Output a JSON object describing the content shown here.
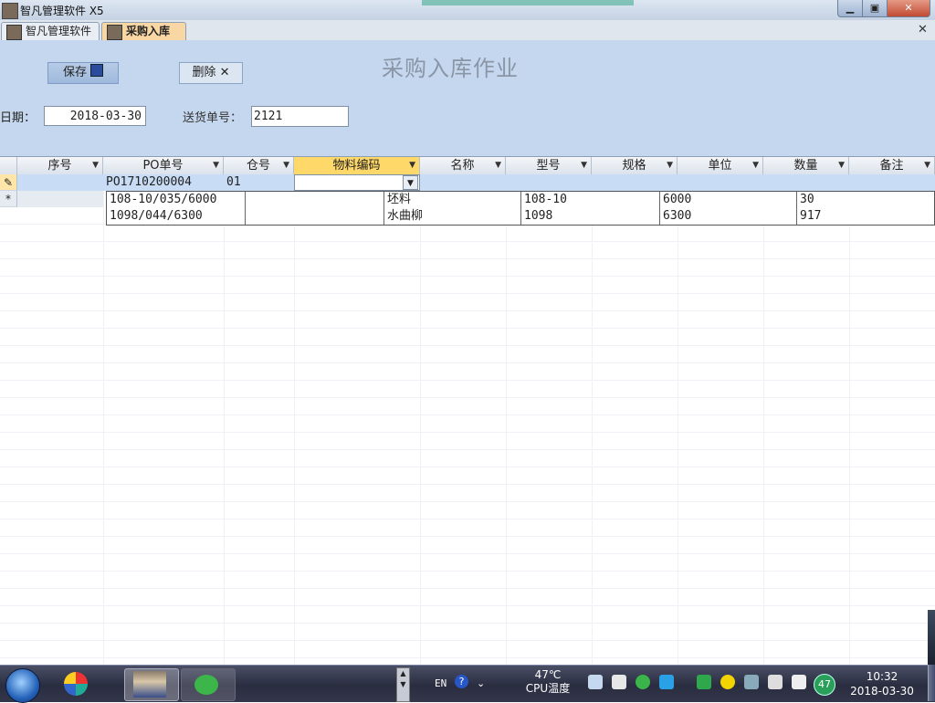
{
  "window": {
    "title": "智凡管理软件 X5",
    "buttons": {
      "minimize": "▁",
      "maximize": "▣",
      "close": "✕"
    }
  },
  "tabs": [
    {
      "label": "智凡管理软件",
      "active": false
    },
    {
      "label": "采购入库",
      "active": true
    }
  ],
  "tab_close": "✕",
  "form": {
    "title": "采购入库作业",
    "save_label": "保存",
    "delete_label": "删除",
    "delete_icon": "✕",
    "date_label": "日期：",
    "date_value": "2018-03-30",
    "delivery_label": "送货单号：",
    "delivery_value": "2121"
  },
  "grid": {
    "columns": [
      "序号",
      "PO单号",
      "仓号",
      "物料编码",
      "名称",
      "型号",
      "规格",
      "单位",
      "数量",
      "备注"
    ],
    "active_column": "物料编码",
    "current_row": {
      "seq": "",
      "po": "PO1710200004",
      "warehouse": "01",
      "material_code": ""
    },
    "row_markers": {
      "editing": "✎",
      "new": "*"
    }
  },
  "dropdown": {
    "rows": [
      [
        "108-10/035/6000",
        "",
        "坯料",
        "108-10",
        "6000",
        "30"
      ],
      [
        "1098/044/6300",
        "",
        "水曲柳",
        "1098",
        "6300",
        "917"
      ]
    ]
  },
  "taskbar": {
    "lang": "EN",
    "help": "?",
    "cpu_temp": "47℃",
    "cpu_label": "CPU温度",
    "badge": "47",
    "time": "10:32",
    "date": "2018-03-30"
  },
  "colors": {
    "header_bg": "#c5d7ee",
    "active_tab": "#f8d7a4",
    "active_column": "#ffd86a",
    "selected_row": "#c9dcf5"
  }
}
